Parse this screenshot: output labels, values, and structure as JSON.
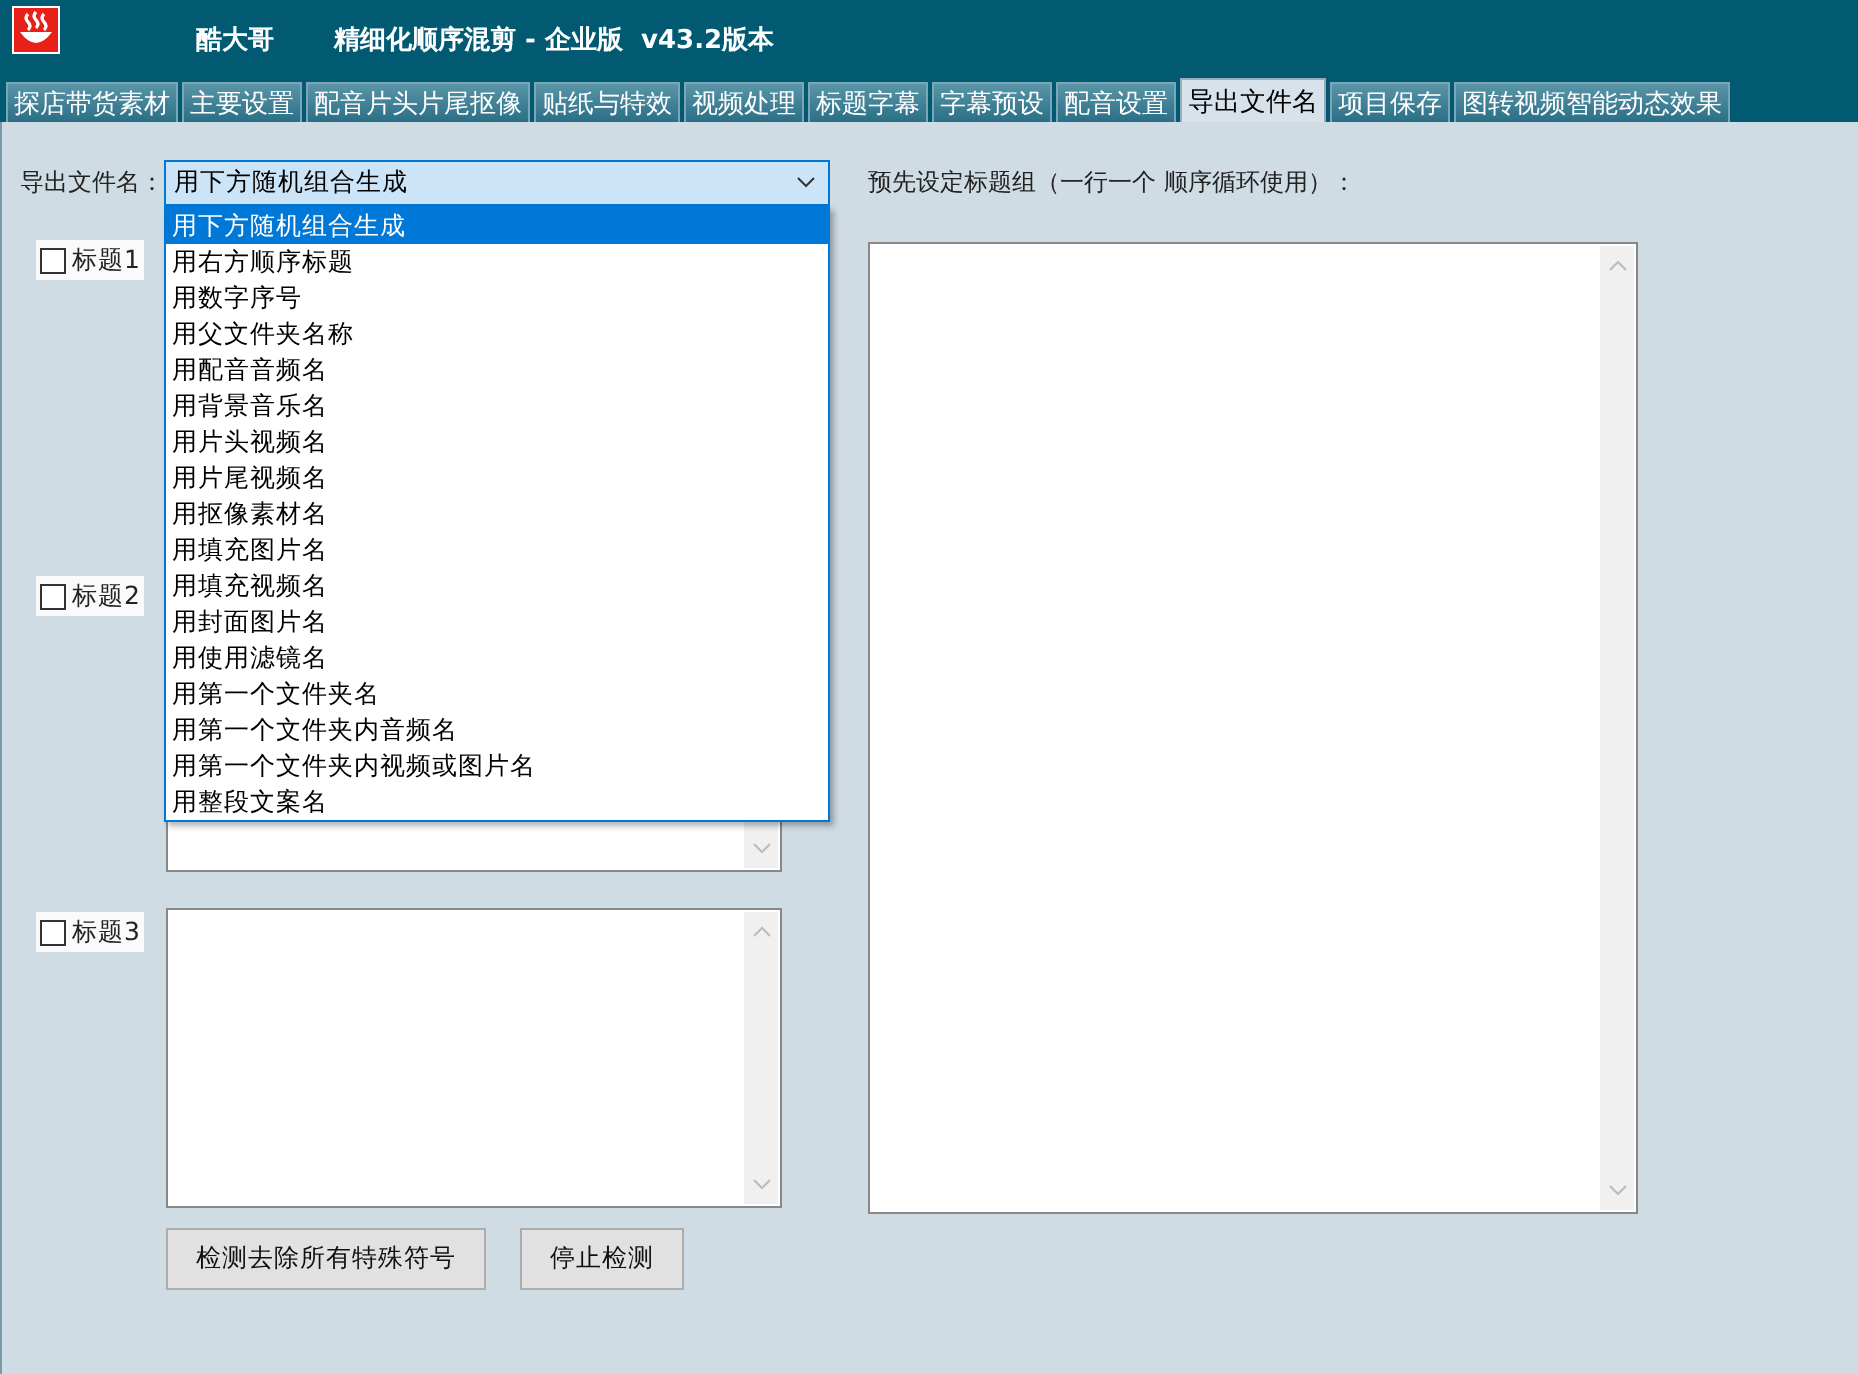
{
  "window": {
    "app_name": "酷大哥",
    "title": "精细化顺序混剪 - 企业版  v43.2版本"
  },
  "tabs": [
    {
      "label": "探店带货素材",
      "selected": false
    },
    {
      "label": "主要设置",
      "selected": false
    },
    {
      "label": "配音片头片尾抠像",
      "selected": false
    },
    {
      "label": "贴纸与特效",
      "selected": false
    },
    {
      "label": "视频处理",
      "selected": false
    },
    {
      "label": "标题字幕",
      "selected": false
    },
    {
      "label": "字幕预设",
      "selected": false
    },
    {
      "label": "配音设置",
      "selected": false
    },
    {
      "label": "导出文件名",
      "selected": true
    },
    {
      "label": "项目保存",
      "selected": false
    },
    {
      "label": "图转视频智能动态效果",
      "selected": false
    }
  ],
  "export_name": {
    "label": "导出文件名：",
    "value": "用下方随机组合生成",
    "expanded": true,
    "options": [
      {
        "label": "用下方随机组合生成",
        "selected": true
      },
      {
        "label": "用右方顺序标题",
        "selected": false
      },
      {
        "label": "用数字序号",
        "selected": false
      },
      {
        "label": "用父文件夹名称",
        "selected": false
      },
      {
        "label": "用配音音频名",
        "selected": false
      },
      {
        "label": "用背景音乐名",
        "selected": false
      },
      {
        "label": "用片头视频名",
        "selected": false
      },
      {
        "label": "用片尾视频名",
        "selected": false
      },
      {
        "label": "用抠像素材名",
        "selected": false
      },
      {
        "label": "用填充图片名",
        "selected": false
      },
      {
        "label": "用填充视频名",
        "selected": false
      },
      {
        "label": "用封面图片名",
        "selected": false
      },
      {
        "label": "用使用滤镜名",
        "selected": false
      },
      {
        "label": "用第一个文件夹名",
        "selected": false
      },
      {
        "label": "用第一个文件夹内音频名",
        "selected": false
      },
      {
        "label": "用第一个文件夹内视频或图片名",
        "selected": false
      },
      {
        "label": "用整段文案名",
        "selected": false
      }
    ]
  },
  "title_fields": [
    {
      "label": "标题1",
      "checked": false
    },
    {
      "label": "标题2",
      "checked": false
    },
    {
      "label": "标题3",
      "checked": false
    }
  ],
  "buttons": [
    "检测去除所有特殊符号",
    "停止检测"
  ],
  "title_group": {
    "label": "预先设定标题组（一行一个 顺序循环使用）："
  }
}
